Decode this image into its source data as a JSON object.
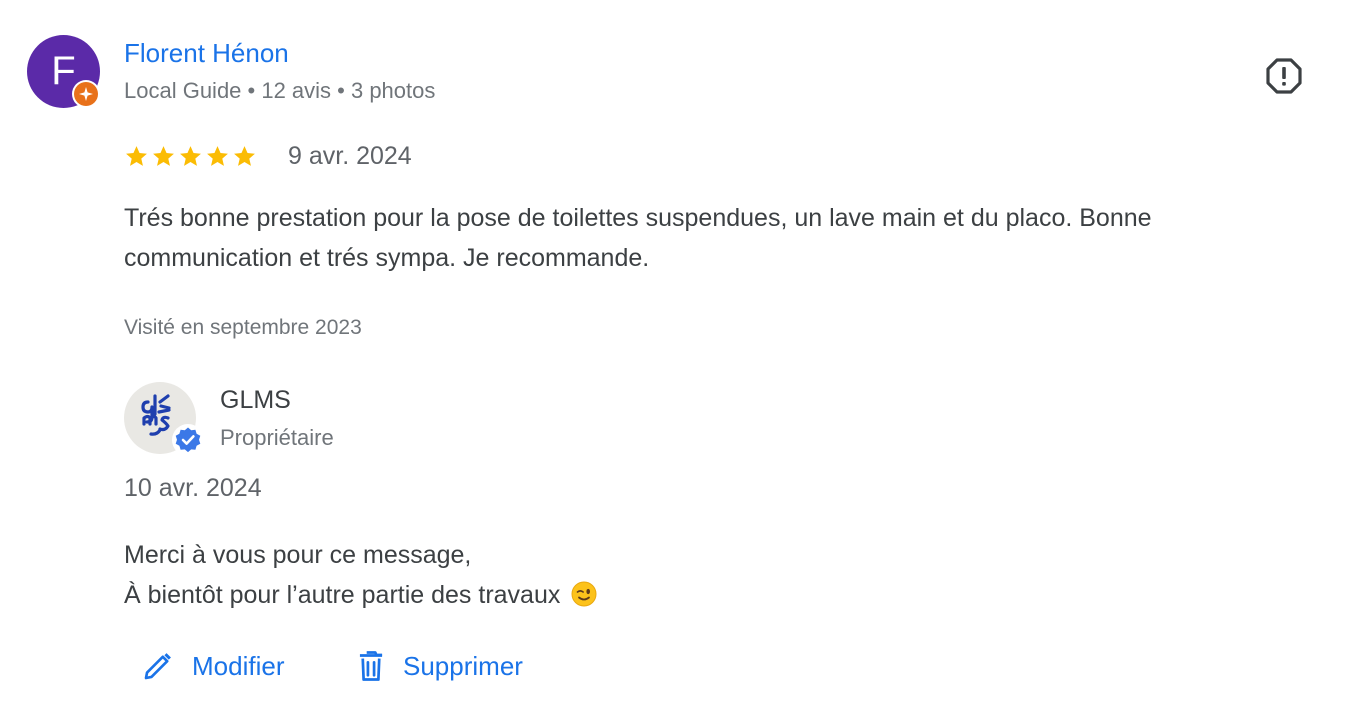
{
  "reviewer": {
    "initial": "F",
    "name": "Florent Hénon",
    "meta": "Local Guide • 12 avis • 3 photos",
    "badge_icon": "local-guide-star-icon",
    "avatar_color": "#5b2aa8",
    "badge_color": "#e8711a"
  },
  "report": {
    "icon": "report-flag-icon"
  },
  "review": {
    "rating": 5,
    "rating_max": 5,
    "star_color": "#fbbc04",
    "date": "9 avr. 2024",
    "text": "Trés bonne prestation pour la pose de toilettes suspendues, un lave main et du placo. Bonne communication et trés sympa. Je recommande.",
    "visited": "Visité en septembre 2023"
  },
  "owner": {
    "name": "GLMS",
    "role": "Propriétaire",
    "verified_icon": "verified-check-icon",
    "logo_color": "#1f3fae"
  },
  "response": {
    "date": "10 avr. 2024",
    "line1": "Merci à vous pour ce message,",
    "line2": "À bientôt pour l’autre partie des travaux",
    "emoji": "winking-face-icon"
  },
  "actions": {
    "modify_label": "Modifier",
    "modify_icon": "pencil-icon",
    "delete_label": "Supprimer",
    "delete_icon": "trash-icon"
  },
  "colors": {
    "link": "#1a73e8",
    "text": "#3c4043",
    "secondary": "#70757a"
  }
}
